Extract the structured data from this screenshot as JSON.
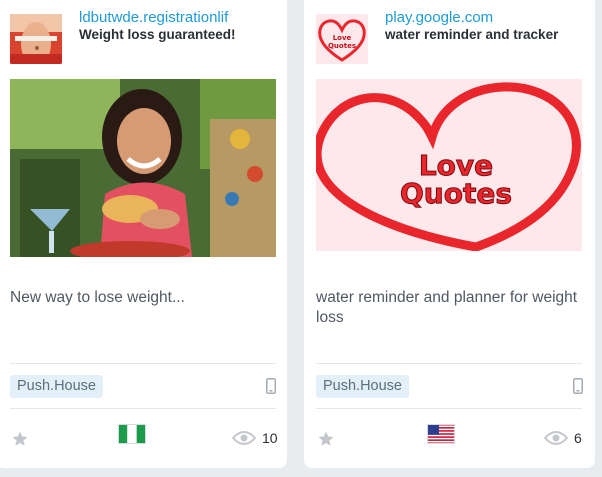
{
  "cards": [
    {
      "domain": "ldbutwde.registrationlif",
      "headline": "Weight loss guaranteed!",
      "body": "New way to lose weight...",
      "network": "Push.House",
      "device_icon": "mobile-phone-icon",
      "flag": "nigeria-flag",
      "views": "10"
    },
    {
      "domain": "play.google.com",
      "headline": "water reminder and tracker",
      "body": "water reminder and planner for weight loss",
      "network": "Push.House",
      "device_icon": "mobile-phone-icon",
      "flag": "usa-flag",
      "views": "6",
      "thumb_text": [
        "Love",
        "Quotes"
      ],
      "creative_text": [
        "Love",
        "Quotes"
      ]
    }
  ],
  "colors": {
    "link": "#1e9bd7",
    "tag_bg": "#e4f0f7",
    "love_red": "#e8262c",
    "background": "#e9ecef"
  }
}
